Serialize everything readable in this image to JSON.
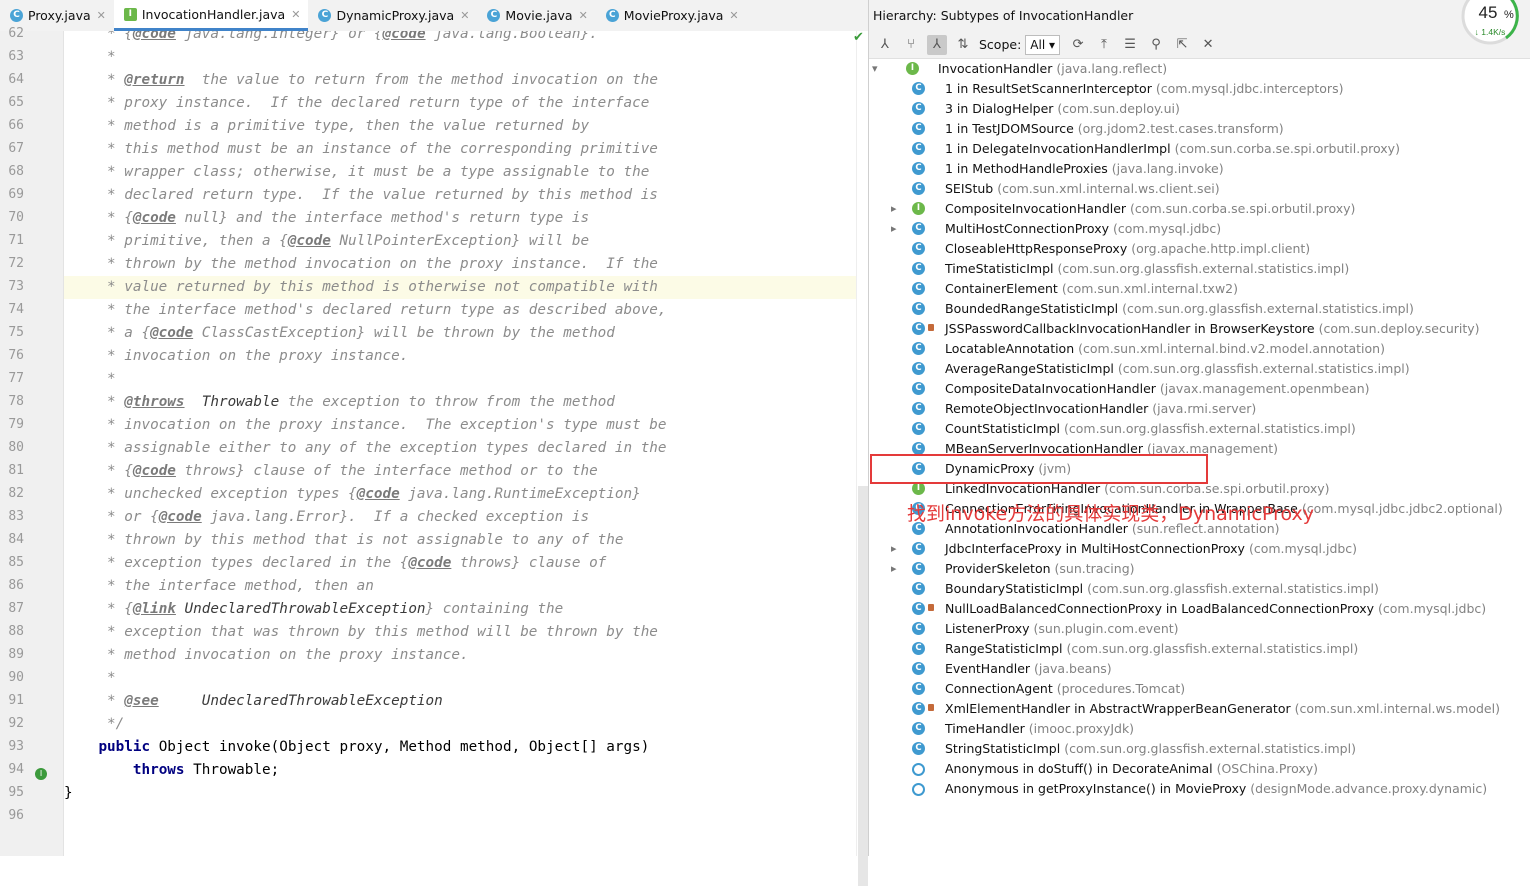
{
  "tabs": [
    {
      "label": "Proxy.java",
      "icon": "C",
      "kind": "class"
    },
    {
      "label": "InvocationHandler.java",
      "icon": "I",
      "kind": "interface",
      "active": true
    },
    {
      "label": "DynamicProxy.java",
      "icon": "C",
      "kind": "class"
    },
    {
      "label": "Movie.java",
      "icon": "C",
      "kind": "class"
    },
    {
      "label": "MovieProxy.java",
      "icon": "C",
      "kind": "class"
    }
  ],
  "code_lines": [
    {
      "n": "62",
      "t": "     * {@code java.lang.Integer} or {@code java.lang.Boolean}."
    },
    {
      "n": "63",
      "t": "     *"
    },
    {
      "n": "64",
      "t": "     * @return  the value to return from the method invocation on the"
    },
    {
      "n": "65",
      "t": "     * proxy instance.  If the declared return type of the interface"
    },
    {
      "n": "66",
      "t": "     * method is a primitive type, then the value returned by"
    },
    {
      "n": "67",
      "t": "     * this method must be an instance of the corresponding primitive"
    },
    {
      "n": "68",
      "t": "     * wrapper class; otherwise, it must be a type assignable to the"
    },
    {
      "n": "69",
      "t": "     * declared return type.  If the value returned by this method is"
    },
    {
      "n": "70",
      "t": "     * {@code null} and the interface method's return type is"
    },
    {
      "n": "71",
      "t": "     * primitive, then a {@code NullPointerException} will be"
    },
    {
      "n": "72",
      "t": "     * thrown by the method invocation on the proxy instance.  If the"
    },
    {
      "n": "73",
      "t": "     * value returned by this method is otherwise not compatible with"
    },
    {
      "n": "74",
      "t": "     * the interface method's declared return type as described above,"
    },
    {
      "n": "75",
      "t": "     * a {@code ClassCastException} will be thrown by the method"
    },
    {
      "n": "76",
      "t": "     * invocation on the proxy instance."
    },
    {
      "n": "77",
      "t": "     *"
    },
    {
      "n": "78",
      "t": "     * @throws  Throwable the exception to throw from the method"
    },
    {
      "n": "79",
      "t": "     * invocation on the proxy instance.  The exception's type must be"
    },
    {
      "n": "80",
      "t": "     * assignable either to any of the exception types declared in the"
    },
    {
      "n": "81",
      "t": "     * {@code throws} clause of the interface method or to the"
    },
    {
      "n": "82",
      "t": "     * unchecked exception types {@code java.lang.RuntimeException}"
    },
    {
      "n": "83",
      "t": "     * or {@code java.lang.Error}.  If a checked exception is"
    },
    {
      "n": "84",
      "t": "     * thrown by this method that is not assignable to any of the"
    },
    {
      "n": "85",
      "t": "     * exception types declared in the {@code throws} clause of"
    },
    {
      "n": "86",
      "t": "     * the interface method, then an"
    },
    {
      "n": "87",
      "t": "     * {@link UndeclaredThrowableException} containing the"
    },
    {
      "n": "88",
      "t": "     * exception that was thrown by this method will be thrown by the"
    },
    {
      "n": "89",
      "t": "     * method invocation on the proxy instance."
    },
    {
      "n": "90",
      "t": "     *"
    },
    {
      "n": "91",
      "t": "     * @see     UndeclaredThrowableException"
    },
    {
      "n": "92",
      "t": "     */"
    },
    {
      "n": "93",
      "t": "    public Object invoke(Object proxy, Method method, Object[] args)",
      "java": true
    },
    {
      "n": "94",
      "t": "        throws Throwable;",
      "java": true
    },
    {
      "n": "95",
      "t": "}",
      "java": true
    },
    {
      "n": "96",
      "t": ""
    }
  ],
  "hierarchy": {
    "title": "Hierarchy:  Subtypes of InvocationHandler",
    "scope_label": "Scope:",
    "scope_value": "All",
    "root": {
      "name": "InvocationHandler",
      "pkg": "(java.lang.reflect)"
    },
    "items": [
      {
        "name": "1 in ResultSetScannerInterceptor",
        "pkg": "(com.mysql.jdbc.interceptors)"
      },
      {
        "name": "3 in DialogHelper",
        "pkg": "(com.sun.deploy.ui)"
      },
      {
        "name": "1 in TestJDOMSource",
        "pkg": "(org.jdom2.test.cases.transform)"
      },
      {
        "name": "1 in DelegateInvocationHandlerImpl",
        "pkg": "(com.sun.corba.se.spi.orbutil.proxy)"
      },
      {
        "name": "1 in MethodHandleProxies",
        "pkg": "(java.lang.invoke)"
      },
      {
        "name": "SEIStub",
        "pkg": "(com.sun.xml.internal.ws.client.sei)"
      },
      {
        "name": "CompositeInvocationHandler",
        "pkg": "(com.sun.corba.se.spi.orbutil.proxy)",
        "expand": true,
        "icon": "I"
      },
      {
        "name": "MultiHostConnectionProxy",
        "pkg": "(com.mysql.jdbc)",
        "expand": true
      },
      {
        "name": "CloseableHttpResponseProxy",
        "pkg": "(org.apache.http.impl.client)"
      },
      {
        "name": "TimeStatisticImpl",
        "pkg": "(com.sun.org.glassfish.external.statistics.impl)"
      },
      {
        "name": "ContainerElement",
        "pkg": "(com.sun.xml.internal.txw2)"
      },
      {
        "name": "BoundedRangeStatisticImpl",
        "pkg": "(com.sun.org.glassfish.external.statistics.impl)"
      },
      {
        "name": "JSSPasswordCallbackInvocationHandler in BrowserKeystore",
        "pkg": "(com.sun.deploy.security)",
        "lock": true
      },
      {
        "name": "LocatableAnnotation",
        "pkg": "(com.sun.xml.internal.bind.v2.model.annotation)"
      },
      {
        "name": "AverageRangeStatisticImpl",
        "pkg": "(com.sun.org.glassfish.external.statistics.impl)"
      },
      {
        "name": "CompositeDataInvocationHandler",
        "pkg": "(javax.management.openmbean)"
      },
      {
        "name": "RemoteObjectInvocationHandler",
        "pkg": "(java.rmi.server)"
      },
      {
        "name": "CountStatisticImpl",
        "pkg": "(com.sun.org.glassfish.external.statistics.impl)"
      },
      {
        "name": "MBeanServerInvocationHandler",
        "pkg": "(javax.management)"
      },
      {
        "name": "DynamicProxy",
        "pkg": "(jvm)"
      },
      {
        "name": "LinkedInvocationHandler",
        "pkg": "(com.sun.corba.se.spi.orbutil.proxy)",
        "icon": "I"
      },
      {
        "name": "ConnectionErrorFiringInvocationHandler in WrapperBase",
        "pkg": "(com.mysql.jdbc.jdbc2.optional)"
      },
      {
        "name": "AnnotationInvocationHandler",
        "pkg": "(sun.reflect.annotation)"
      },
      {
        "name": "JdbcInterfaceProxy in MultiHostConnectionProxy",
        "pkg": "(com.mysql.jdbc)",
        "expand": true
      },
      {
        "name": "ProviderSkeleton",
        "pkg": "(sun.tracing)",
        "expand": true
      },
      {
        "name": "BoundaryStatisticImpl",
        "pkg": "(com.sun.org.glassfish.external.statistics.impl)"
      },
      {
        "name": "NullLoadBalancedConnectionProxy in LoadBalancedConnectionProxy",
        "pkg": "(com.mysql.jdbc)",
        "lock": true
      },
      {
        "name": "ListenerProxy",
        "pkg": "(sun.plugin.com.event)"
      },
      {
        "name": "RangeStatisticImpl",
        "pkg": "(com.sun.org.glassfish.external.statistics.impl)"
      },
      {
        "name": "EventHandler",
        "pkg": "(java.beans)"
      },
      {
        "name": "ConnectionAgent",
        "pkg": "(procedures.Tomcat)"
      },
      {
        "name": "XmlElementHandler in AbstractWrapperBeanGenerator",
        "pkg": "(com.sun.xml.internal.ws.model)",
        "lock": true
      },
      {
        "name": "TimeHandler",
        "pkg": "(imooc.proxyJdk)"
      },
      {
        "name": "StringStatisticImpl",
        "pkg": "(com.sun.org.glassfish.external.statistics.impl)"
      },
      {
        "name": "Anonymous in doStuff() in DecorateAnimal",
        "pkg": "(OSChina.Proxy)",
        "anon": true
      },
      {
        "name": "Anonymous in getProxyInstance() in MovieProxy",
        "pkg": "(designMode.advance.proxy.dynamic)",
        "anon": true
      }
    ]
  },
  "annotation": "找到invoke方法的具体实现类，DynamicProxy",
  "gauge": {
    "percent": "45",
    "unit": "%",
    "rate": "↓ 1.4K/s"
  },
  "colors": {
    "annotation": "#e43a3a",
    "tab_active": "#4083c9"
  }
}
